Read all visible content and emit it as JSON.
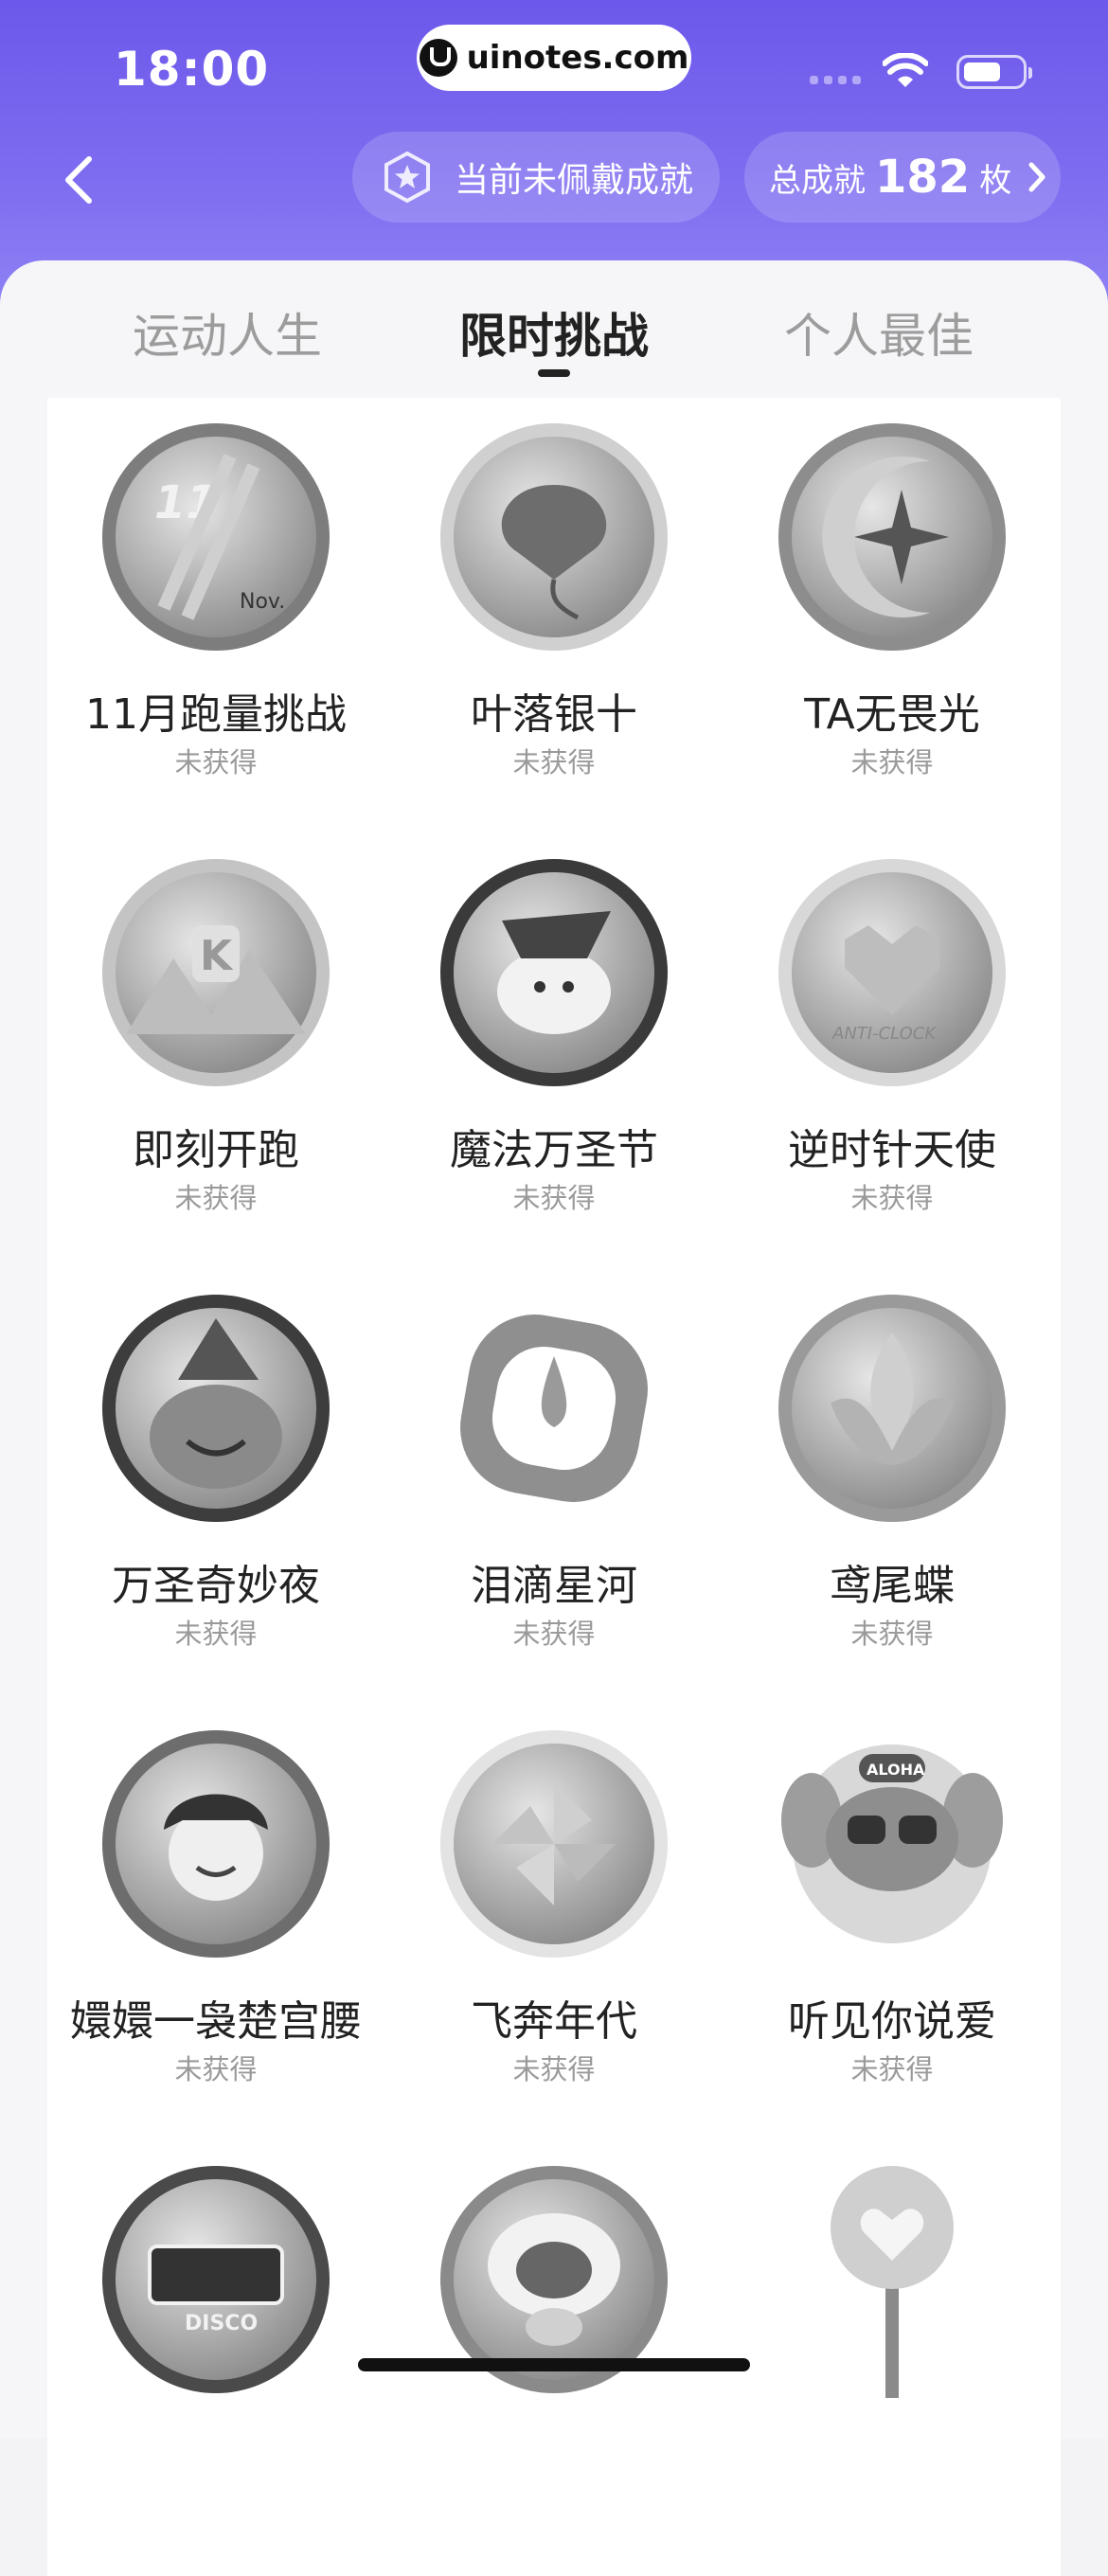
{
  "status_bar": {
    "time": "18:00",
    "url": "uinotes.com"
  },
  "nav": {
    "current_badge_text": "当前未佩戴成就",
    "total_label": "总成就",
    "total_count": "182",
    "total_unit": "枚"
  },
  "tabs": [
    {
      "label": "运动人生",
      "active": false
    },
    {
      "label": "限时挑战",
      "active": true
    },
    {
      "label": "个人最佳",
      "active": false
    }
  ],
  "achievements": [
    {
      "name": "11月跑量挑战",
      "status": "未获得",
      "icon": "november-run-medal-icon"
    },
    {
      "name": "叶落银十",
      "status": "未获得",
      "icon": "ginkgo-leaf-medal-icon"
    },
    {
      "name": "TA无畏光",
      "status": "未获得",
      "icon": "moon-star-medal-icon"
    },
    {
      "name": "即刻开跑",
      "status": "未获得",
      "icon": "mountain-k-medal-icon"
    },
    {
      "name": "魔法万圣节",
      "status": "未获得",
      "icon": "magic-halloween-medal-icon"
    },
    {
      "name": "逆时针天使",
      "status": "未获得",
      "icon": "pixel-heart-medal-icon"
    },
    {
      "name": "万圣奇妙夜",
      "status": "未获得",
      "icon": "pumpkin-night-medal-icon"
    },
    {
      "name": "泪滴星河",
      "status": "未获得",
      "icon": "teardrop-medal-icon"
    },
    {
      "name": "鸢尾蝶",
      "status": "未获得",
      "icon": "iris-flower-medal-icon"
    },
    {
      "name": "嬛嬛一袅楚宫腰",
      "status": "未获得",
      "icon": "palace-girl-medal-icon"
    },
    {
      "name": "飞奔年代",
      "status": "未获得",
      "icon": "pinwheel-medal-icon"
    },
    {
      "name": "听见你说爱",
      "status": "未获得",
      "icon": "stitch-medal-icon"
    },
    {
      "name": "",
      "status": "",
      "icon": "disco-medal-icon"
    },
    {
      "name": "",
      "status": "",
      "icon": "sheep-medal-icon"
    },
    {
      "name": "",
      "status": "",
      "icon": "heart-lamp-medal-icon"
    }
  ],
  "colors": {
    "header_start": "#6c58ea",
    "header_end": "#8f82f4",
    "text_primary": "#222222",
    "text_secondary": "#9a9a9a",
    "tab_inactive": "#9c9c9c"
  }
}
